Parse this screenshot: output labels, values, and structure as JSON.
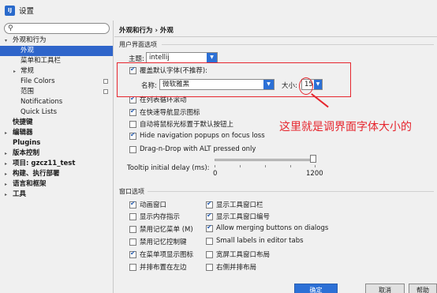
{
  "window": {
    "title": "设置",
    "app_icon": "IJ"
  },
  "search": {
    "placeholder": ""
  },
  "sidebar": {
    "items": [
      {
        "label": "外观和行为",
        "arrow": "▾"
      },
      {
        "label": "外观"
      },
      {
        "label": "菜单和工具栏"
      },
      {
        "label": "常规",
        "arrow": "▸"
      },
      {
        "label": "File Colors"
      },
      {
        "label": "范围"
      },
      {
        "label": "Notifications"
      },
      {
        "label": "Quick Lists"
      },
      {
        "label": "快捷键"
      },
      {
        "label": "编辑器",
        "arrow": "▸"
      },
      {
        "label": "Plugins"
      },
      {
        "label": "版本控制",
        "arrow": "▸"
      },
      {
        "label": "项目: gzcz11_test",
        "arrow": "▸"
      },
      {
        "label": "构建、执行部署",
        "arrow": "▸"
      },
      {
        "label": "语言和框架",
        "arrow": "▸"
      },
      {
        "label": "工具",
        "arrow": "▸"
      }
    ]
  },
  "main": {
    "breadcrumb": "外观和行为 › 外观",
    "ui_options": {
      "section_title": "用户界面选项",
      "theme_label": "主题:",
      "theme_value": "intellij",
      "override_font_label": "覆盖默认字体(不推荐):",
      "font_name_label": "名称:",
      "font_name_value": "微软雅黑",
      "font_size_label": "大小:",
      "font_size_value": "15",
      "options": [
        {
          "label": "在列表循环滚动",
          "checked": true
        },
        {
          "label": "在快速导航显示图标",
          "checked": true
        },
        {
          "label": "自动将鼠标光标置于默认按钮上",
          "checked": false
        },
        {
          "label": "Hide navigation popups on focus loss",
          "checked": true
        },
        {
          "label": "Drag-n-Drop with ALT pressed only",
          "checked": false
        }
      ],
      "tooltip_label": "Tooltip initial delay (ms):",
      "tooltip_value": 1200,
      "tooltip_min": "0",
      "tooltip_max": "1200"
    },
    "window_options": {
      "section_title": "窗口选项",
      "left": [
        {
          "label": "动画窗口",
          "checked": true
        },
        {
          "label": "显示内存指示",
          "checked": false
        },
        {
          "label": "禁用记忆菜单 (M)",
          "checked": false
        },
        {
          "label": "禁用记忆控制键",
          "checked": false
        },
        {
          "label": "在菜单项显示图标",
          "checked": true
        },
        {
          "label": "并排布置在左边",
          "checked": false
        }
      ],
      "right": [
        {
          "label": "显示工具窗口栏",
          "checked": true
        },
        {
          "label": "显示工具窗口编号",
          "checked": true
        },
        {
          "label": "Allow merging buttons on dialogs",
          "checked": true
        },
        {
          "label": "Small labels in editor tabs",
          "checked": false
        },
        {
          "label": "宽屏工具窗口布局",
          "checked": false
        },
        {
          "label": "右侧并排布局",
          "checked": false
        }
      ]
    },
    "annotation": "这里就是调界面字体大小的",
    "buttons": {
      "ok": "确定",
      "cancel": "取消",
      "help": "帮助"
    }
  }
}
